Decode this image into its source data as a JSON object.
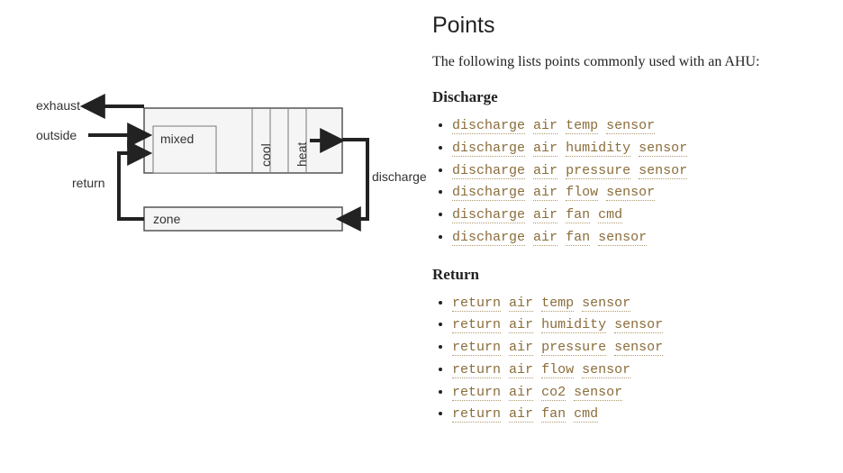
{
  "section": {
    "title": "Points"
  },
  "intro": "The following lists points commonly used with an AHU:",
  "groups": [
    {
      "title": "Discharge",
      "points": [
        [
          "discharge",
          "air",
          "temp",
          "sensor"
        ],
        [
          "discharge",
          "air",
          "humidity",
          "sensor"
        ],
        [
          "discharge",
          "air",
          "pressure",
          "sensor"
        ],
        [
          "discharge",
          "air",
          "flow",
          "sensor"
        ],
        [
          "discharge",
          "air",
          "fan",
          "cmd"
        ],
        [
          "discharge",
          "air",
          "fan",
          "sensor"
        ]
      ]
    },
    {
      "title": "Return",
      "points": [
        [
          "return",
          "air",
          "temp",
          "sensor"
        ],
        [
          "return",
          "air",
          "humidity",
          "sensor"
        ],
        [
          "return",
          "air",
          "pressure",
          "sensor"
        ],
        [
          "return",
          "air",
          "flow",
          "sensor"
        ],
        [
          "return",
          "air",
          "co2",
          "sensor"
        ],
        [
          "return",
          "air",
          "fan",
          "cmd"
        ]
      ]
    }
  ],
  "diagram": {
    "exhaust": "exhaust",
    "outside": "outside",
    "return": "return",
    "mixed": "mixed",
    "cool": "cool",
    "heat": "heat",
    "discharge": "discharge",
    "zone": "zone"
  }
}
